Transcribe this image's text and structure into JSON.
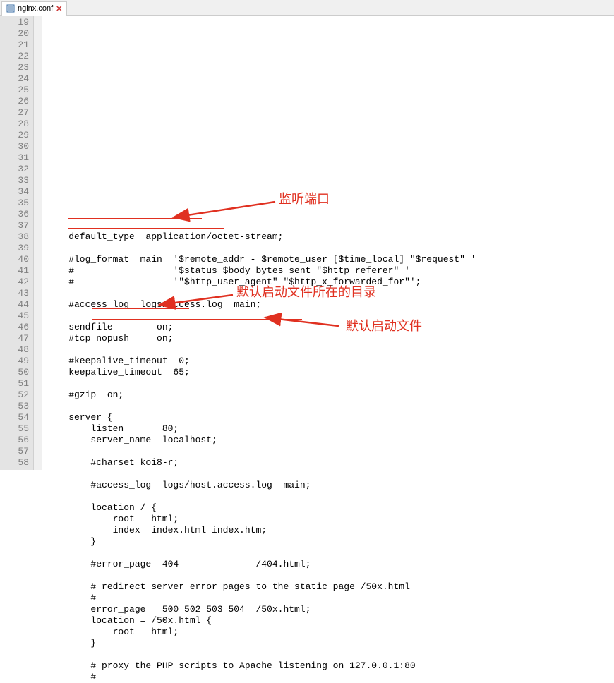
{
  "tab": {
    "filename": "nginx.conf",
    "close_glyph": "✕"
  },
  "gutter": {
    "start": 19,
    "end": 58
  },
  "code_lines": [
    "    default_type  application/octet-stream;",
    "",
    "    #log_format  main  '$remote_addr - $remote_user [$time_local] \"$request\" '",
    "    #                  '$status $body_bytes_sent \"$http_referer\" '",
    "    #                  '\"$http_user_agent\" \"$http_x_forwarded_for\"';",
    "",
    "    #access_log  logs/access.log  main;",
    "",
    "    sendfile        on;",
    "    #tcp_nopush     on;",
    "",
    "    #keepalive_timeout  0;",
    "    keepalive_timeout  65;",
    "",
    "    #gzip  on;",
    "",
    "    server {",
    "        listen       80;",
    "        server_name  localhost;",
    "",
    "        #charset koi8-r;",
    "",
    "        #access_log  logs/host.access.log  main;",
    "",
    "        location / {",
    "            root   html;",
    "            index  index.html index.htm;",
    "        }",
    "",
    "        #error_page  404              /404.html;",
    "",
    "        # redirect server error pages to the static page /50x.html",
    "        #",
    "        error_page   500 502 503 504  /50x.html;",
    "        location = /50x.html {",
    "            root   html;",
    "        }",
    "",
    "        # proxy the PHP scripts to Apache listening on 127.0.0.1:80",
    "        #"
  ],
  "annotations": {
    "a1": "监听端口",
    "a2": "默认启动文件所在的目录",
    "a3": "默认启动文件"
  }
}
